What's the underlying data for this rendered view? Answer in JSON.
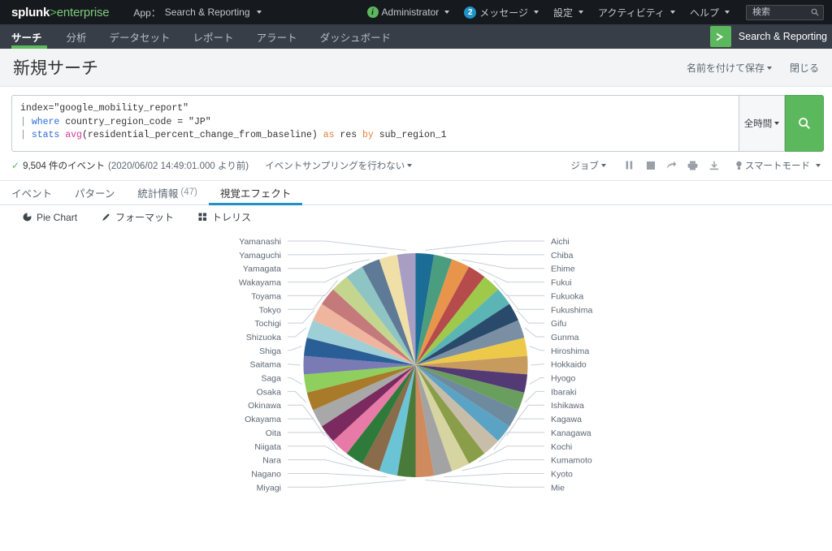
{
  "topbar": {
    "logo": {
      "part1": "splunk",
      "part2": ">",
      "part3": "enterprise"
    },
    "app_label": "App：",
    "app_value": "Search & Reporting",
    "user": "Administrator",
    "info_badge": "i",
    "messages_label": "メッセージ",
    "messages_count": "2",
    "settings": "設定",
    "activity": "アクティビティ",
    "help": "ヘルプ",
    "search_placeholder": "検索",
    "search_value": ""
  },
  "navbar": {
    "items": [
      {
        "label": "サーチ",
        "active": true
      },
      {
        "label": "分析",
        "active": false
      },
      {
        "label": "データセット",
        "active": false
      },
      {
        "label": "レポート",
        "active": false
      },
      {
        "label": "アラート",
        "active": false
      },
      {
        "label": "ダッシュボード",
        "active": false
      }
    ],
    "app_name": "Search & Reporting"
  },
  "title": {
    "heading": "新規サーチ",
    "save_as": "名前を付けて保存",
    "close": "閉じる"
  },
  "search": {
    "line1_plain": "index=\"google_mobility_report\"",
    "line2": {
      "pipe": "|",
      "kw": "where",
      "rest": " country_region_code = \"JP\""
    },
    "line3": {
      "pipe": "|",
      "kw": "stats",
      "fn": "avg",
      "mid": "(residential_percent_change_from_baseline) ",
      "as": "as",
      "res": " res ",
      "by": "by",
      "field": " sub_region_1"
    },
    "time_range": "全時間",
    "search_button_icon": "search-icon"
  },
  "status": {
    "check": "✓",
    "event_count": "9,504 件のイベント",
    "event_time": "(2020/06/02 14:49:01.000 より前)",
    "sampling": "イベントサンプリングを行わない",
    "job_menu": "ジョブ",
    "tool_icons": [
      "pause-icon",
      "stop-icon",
      "share-icon",
      "print-icon",
      "export-icon"
    ],
    "mode": "スマートモード"
  },
  "result_tabs": [
    {
      "label": "イベント",
      "count": "",
      "active": false
    },
    {
      "label": "パターン",
      "count": "",
      "active": false
    },
    {
      "label": "統計情報",
      "count": "(47)",
      "active": false
    },
    {
      "label": "視覚エフェクト",
      "count": "",
      "active": true
    }
  ],
  "viz_toolbar": [
    {
      "icon": "pie-chart-icon",
      "label": "Pie Chart"
    },
    {
      "icon": "pencil-icon",
      "label": "フォーマット"
    },
    {
      "icon": "trellis-grid-icon",
      "label": "トレリス"
    }
  ],
  "chart_data": {
    "type": "pie",
    "title": "",
    "legend_position": "labels-with-leader-lines",
    "value_field": "res",
    "category_field": "sub_region_1",
    "labels_right": [
      "Aichi",
      "Chiba",
      "Ehime",
      "Fukui",
      "Fukuoka",
      "Fukushima",
      "Gifu",
      "Gunma",
      "Hiroshima",
      "Hokkaido",
      "Hyogo",
      "Ibaraki",
      "Ishikawa",
      "Kagawa",
      "Kanagawa",
      "Kochi",
      "Kumamoto",
      "Kyoto",
      "Mie"
    ],
    "labels_left": [
      "Yamanashi",
      "Yamaguchi",
      "Yamagata",
      "Wakayama",
      "Toyama",
      "Tokyo",
      "Tochigi",
      "Shizuoka",
      "Shiga",
      "Saitama",
      "Saga",
      "Osaka",
      "Okinawa",
      "Okayama",
      "Oita",
      "Niigata",
      "Nara",
      "Nagano",
      "Miyagi"
    ],
    "categories": [
      "Aichi",
      "Chiba",
      "Ehime",
      "Fukui",
      "Fukuoka",
      "Fukushima",
      "Gifu",
      "Gunma",
      "Hiroshima",
      "Hokkaido",
      "Hyogo",
      "Ibaraki",
      "Ishikawa",
      "Kagawa",
      "Kanagawa",
      "Kochi",
      "Kumamoto",
      "Kyoto",
      "Mie",
      "Miyagi",
      "Nagano",
      "Nara",
      "Niigata",
      "Oita",
      "Okayama",
      "Okinawa",
      "Osaka",
      "Saga",
      "Saitama",
      "Shiga",
      "Shizuoka",
      "Tochigi",
      "Tokyo",
      "Toyama",
      "Wakayama",
      "Yamagata",
      "Yamaguchi",
      "Yamanashi"
    ],
    "values": [
      2.63,
      2.63,
      2.63,
      2.63,
      2.63,
      2.63,
      2.63,
      2.63,
      2.63,
      2.63,
      2.63,
      2.63,
      2.63,
      2.63,
      2.63,
      2.63,
      2.63,
      2.63,
      2.63,
      2.63,
      2.63,
      2.63,
      2.63,
      2.63,
      2.63,
      2.63,
      2.63,
      2.63,
      2.63,
      2.63,
      2.63,
      2.63,
      2.63,
      2.63,
      2.63,
      2.63,
      2.63,
      2.63
    ],
    "colors": [
      "#1b6d96",
      "#4a9e7f",
      "#e8944a",
      "#b54b4b",
      "#9ec martial",
      "#5bb5b5",
      "#2a4a6b",
      "#7a8fa3",
      "#edc94a",
      "#c79a5e",
      "#533a74",
      "#6a9e5e",
      "#7a8fa3",
      "#5ba3c4",
      "#c7bda8",
      "#8a9e5e",
      "#d6d4a8",
      "#9e9e9e",
      "#cf8a5e",
      "#4a7a3a",
      "#6bc4d6",
      "#8a6b4a",
      "#2d7a3a",
      "#e87aa8",
      "#7a2a5e",
      "#a8a8a8",
      "#a87a2a",
      "#8ecf5e",
      "#7a7ab5",
      "#2a5e96",
      "#9ecfd6",
      "#f0b59e",
      "#c47a7a",
      "#c4d68e",
      "#8fc4c4",
      "#5e7a96",
      "#f0e0a8",
      "#a89ec4"
    ]
  }
}
